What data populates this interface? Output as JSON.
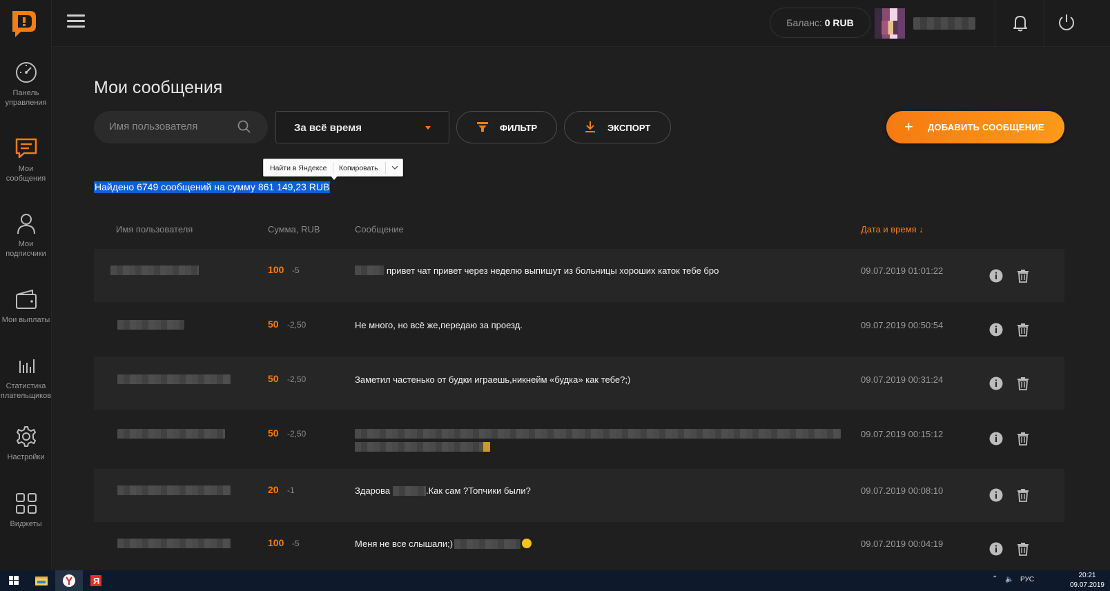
{
  "topbar": {
    "balance_label": "Баланс:",
    "balance_value": "0 RUB"
  },
  "sidebar": {
    "items": [
      {
        "label": "Панель\nуправления",
        "icon": "dashboard-icon"
      },
      {
        "label": "Мои\nсообщения",
        "icon": "messages-icon"
      },
      {
        "label": "Мои\nподписчики",
        "icon": "user-icon"
      },
      {
        "label": "Мои выплаты",
        "icon": "wallet-icon"
      },
      {
        "label": "Статистика\nплательщиков",
        "icon": "stats-icon"
      },
      {
        "label": "Настройки",
        "icon": "gear-icon"
      },
      {
        "label": "Виджеты",
        "icon": "widgets-icon"
      }
    ]
  },
  "main": {
    "title": "Мои сообщения",
    "search_placeholder": "Имя пользователя",
    "period": "За всё время",
    "filter_label": "ФИЛЬТР",
    "export_label": "ЭКСПОРТ",
    "add_label": "ДОБАВИТЬ СООБЩЕНИЕ",
    "found_text": "Найдено 6749 сообщений на сумму 861 149,23 RUB"
  },
  "context_menu": {
    "search": "Найти в Яндексе",
    "copy": "Копировать"
  },
  "table": {
    "headers": {
      "user": "Имя пользователя",
      "amount": "Сумма, RUB",
      "message": "Сообщение",
      "datetime": "Дата и время ↓"
    },
    "rows": [
      {
        "amount": "100",
        "fee": "-5",
        "message": "привет чат привет через неделю выпишут из больницы хороших каток тебе бро",
        "datetime": "09.07.2019 01:01:22"
      },
      {
        "amount": "50",
        "fee": "-2,50",
        "message": "Не много, но всё же,передаю за проезд.",
        "datetime": "09.07.2019 00:50:54"
      },
      {
        "amount": "50",
        "fee": "-2,50",
        "message": "Заметил частенько от будки играешь,никнейм «будка» как тебе?;)",
        "datetime": "09.07.2019 00:31:24"
      },
      {
        "amount": "50",
        "fee": "-2,50",
        "message": "",
        "datetime": "09.07.2019 00:15:12"
      },
      {
        "amount": "20",
        "fee": "-1",
        "message_pre": "Здарова",
        "message_post": ".Как сам ?Топчики были?",
        "datetime": "09.07.2019 00:08:10"
      },
      {
        "amount": "100",
        "fee": "-5",
        "message": "Меня не все слышали;)",
        "datetime": "09.07.2019 00:04:19"
      }
    ]
  },
  "taskbar": {
    "lang": "РУС",
    "time": "20:21",
    "date": "09.07.2019"
  },
  "colors": {
    "accent": "#f57d12",
    "selection": "#0c5fd6",
    "background": "#1f1f1f"
  }
}
